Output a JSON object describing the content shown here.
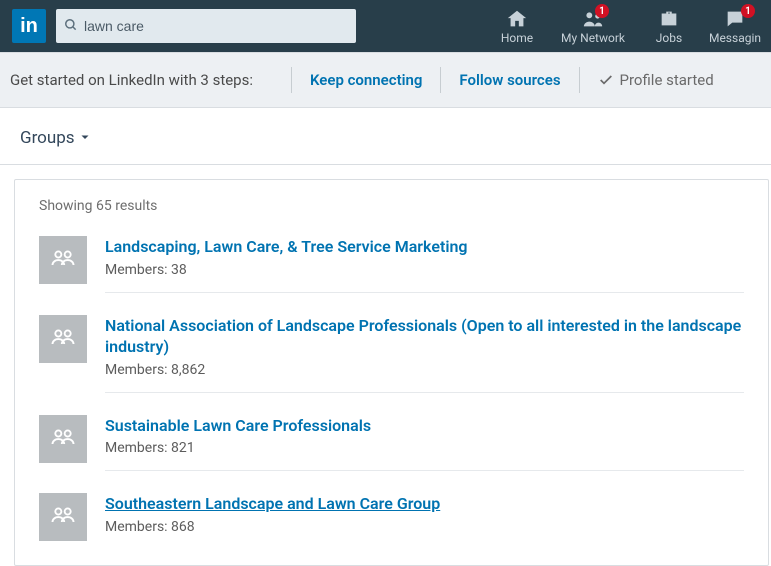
{
  "header": {
    "logo_text": "in",
    "search_value": "lawn care",
    "nav": {
      "home": "Home",
      "network": "My Network",
      "network_badge": "1",
      "jobs": "Jobs",
      "messaging": "Messagin",
      "messaging_badge": "1"
    }
  },
  "get_started": {
    "text": "Get started on LinkedIn with 3 steps:",
    "keep_connecting": "Keep connecting",
    "follow_sources": "Follow sources",
    "profile_started": "Profile started"
  },
  "filter": {
    "label": "Groups"
  },
  "results": {
    "count_text": "Showing 65 results",
    "items": [
      {
        "title": "Landscaping, Lawn Care, & Tree Service Marketing",
        "members_label": "Members: 38",
        "underline": false
      },
      {
        "title": "National Association of Landscape Professionals (Open to all interested in the landscape industry)",
        "members_label": "Members: 8,862",
        "underline": false
      },
      {
        "title": "Sustainable Lawn Care Professionals",
        "members_label": "Members: 821",
        "underline": false
      },
      {
        "title": "Southeastern Landscape and Lawn Care Group",
        "members_label": "Members: 868",
        "underline": true
      }
    ]
  }
}
